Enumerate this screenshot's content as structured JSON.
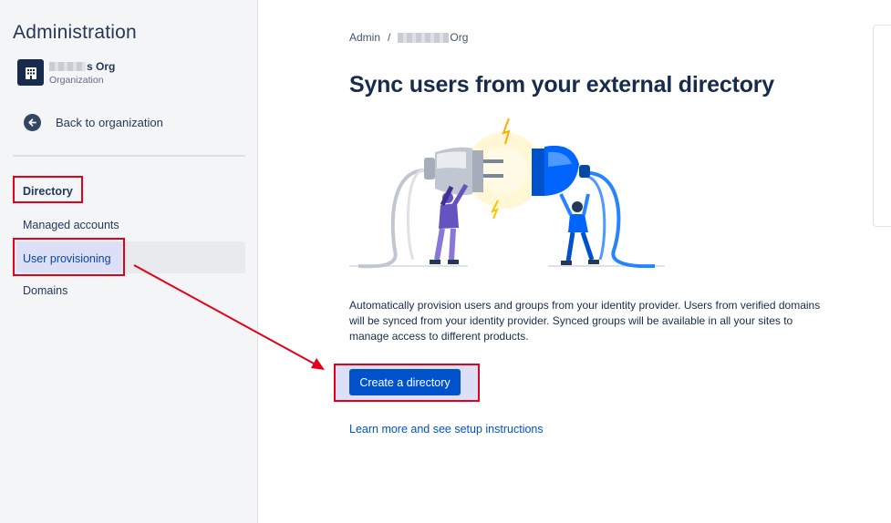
{
  "sidebar": {
    "title": "Administration",
    "org_name_suffix": "s Org",
    "org_subtitle": "Organization",
    "back_label": "Back to organization",
    "section_heading": "Directory",
    "items": [
      {
        "label": "Managed accounts",
        "active": false
      },
      {
        "label": "User provisioning",
        "active": true
      },
      {
        "label": "Domains",
        "active": false
      }
    ]
  },
  "breadcrumb": {
    "root": "Admin",
    "separator": "/",
    "org_suffix": "Org"
  },
  "main": {
    "title": "Sync users from your external directory",
    "description": "Automatically provision users and groups from your identity provider. Users from verified domains will be synced from your identity provider. Synced groups will be available in all your sites to manage access to different products.",
    "cta_label": "Create a directory",
    "learn_more_label": "Learn more and see setup instructions"
  },
  "colors": {
    "primary": "#0052CC",
    "annotation": "#E2001A",
    "sidebar_bg": "#F4F5F7",
    "text": "#172B4D"
  },
  "icons": {
    "org": "building-icon",
    "back": "arrow-left-circle-icon"
  }
}
